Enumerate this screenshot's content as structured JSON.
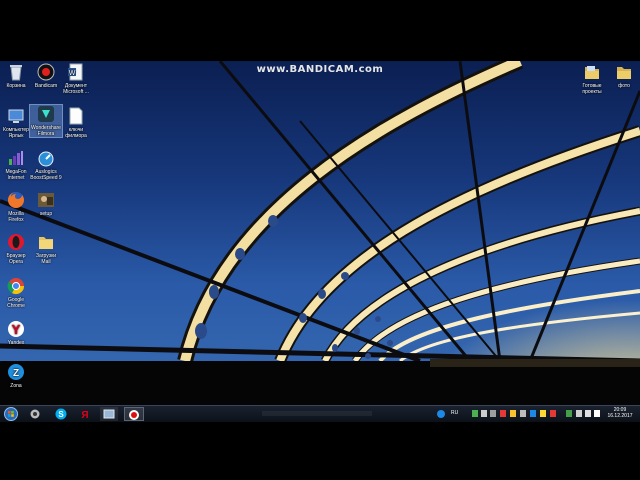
{
  "watermark": "www.BANDICAM.com",
  "desktop_icons": {
    "recycle": "Корзина",
    "bandicam": "Bandicam",
    "doc_line1": "Документ",
    "doc_line2": "Microsoft ...",
    "computer_line1": "Компьютер",
    "computer_line2": "Ярлык",
    "wondershare_line1": "Wondershare",
    "wondershare_line2": "Filmora",
    "keys_line1": "ключи",
    "keys_line2": "филмора",
    "megafon_line1": "MegaFon",
    "megafon_line2": "Internet",
    "auslogics_line1": "Auslogics",
    "auslogics_line2": "BoostSpeed 9",
    "firefox_line1": "Mozilla",
    "firefox_line2": "Firefox",
    "setup": "setup",
    "opera_line1": "Браузер",
    "opera_line2": "Opera",
    "downloads_line1": "Загрузки",
    "downloads_line2": "Mail",
    "chrome_line1": "Google",
    "chrome_line2": "Chrome",
    "yandex": "Yandex",
    "zona": "Zona",
    "ready_line1": "Готовые",
    "ready_line2": "проекты",
    "photo": "фото"
  },
  "taskbar": {
    "language": "RU",
    "time": "20:09",
    "date": "16.12.2017"
  },
  "colors": {
    "sky_top": "#0b1f52",
    "sky_bottom": "#3a6db3",
    "bridge_glow": "#f2d890",
    "taskbar": "#111822"
  },
  "icons": [
    "recycle-bin-icon",
    "bandicam-icon",
    "word-document-icon",
    "computer-icon",
    "filmora-icon",
    "text-file-icon",
    "megafon-icon",
    "auslogics-icon",
    "firefox-icon",
    "setup-icon",
    "opera-icon",
    "folder-icon",
    "chrome-icon",
    "yandex-icon",
    "zona-icon",
    "start-icon",
    "skype-icon",
    "windows-explorer-icon",
    "record-icon"
  ]
}
